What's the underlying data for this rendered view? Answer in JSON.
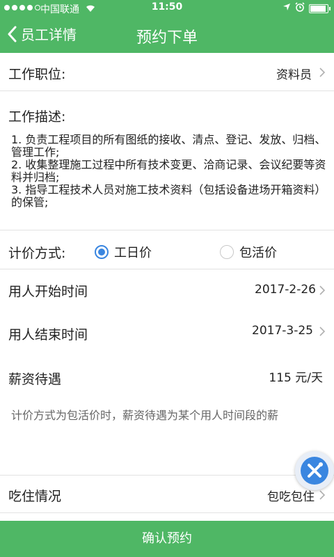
{
  "status_bar": {
    "carrier": "中国联通",
    "time": "11:50",
    "battery_level": 0.9
  },
  "nav": {
    "back_label": "员工详情",
    "title": "预约下单"
  },
  "position": {
    "label": "工作职位:",
    "value": "资料员"
  },
  "description": {
    "label": "工作描述:",
    "lines": [
      "1. 负责工程项目的所有图纸的接收、清点、登记、发放、归档、管理工作;",
      "2. 收集整理施工过程中所有技术变更、洽商记录、会议纪要等资料并归档;",
      "3. 指导工程技术人员对施工技术资料（包括设备进场开箱资料）的保管;"
    ]
  },
  "pricing": {
    "label": "计价方式:",
    "options": [
      {
        "label": "工日价",
        "checked": true
      },
      {
        "label": "包活价",
        "checked": false
      }
    ]
  },
  "start_time": {
    "label": "用人开始时间",
    "value": "2017-2-26"
  },
  "end_time": {
    "label": "用人结束时间",
    "value": "2017-3-25"
  },
  "salary": {
    "label": "薪资待遇",
    "value": "115 元/天"
  },
  "note": "计价方式为包活价时，薪资待遇为某个用人时间段的薪",
  "board": {
    "label": "吃住情况",
    "value": "包吃包住"
  },
  "confirm_label": "确认预约",
  "colors": {
    "primary": "#4fb765",
    "radio_accent": "#3a86e0"
  }
}
